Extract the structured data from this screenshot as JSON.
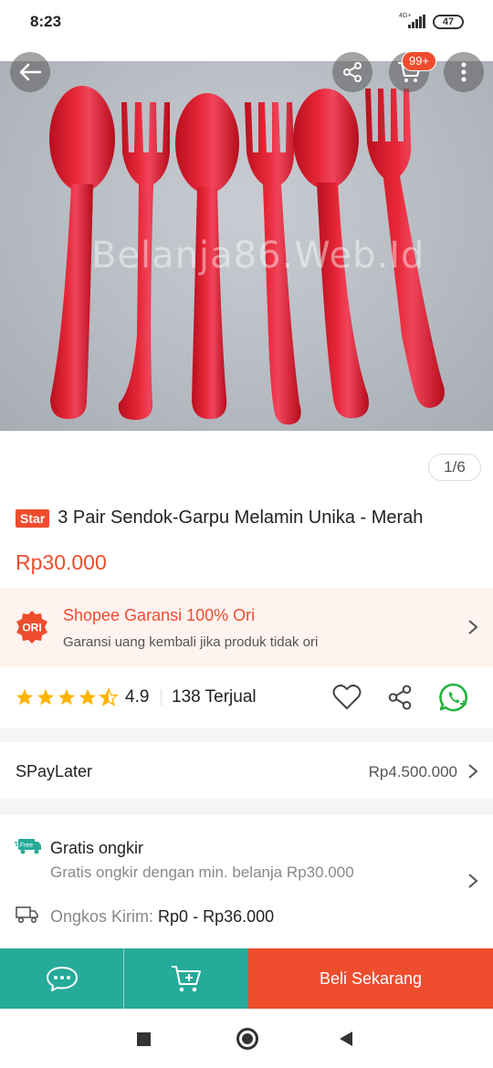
{
  "status_bar": {
    "time": "8:23",
    "network": "4G+",
    "battery": "47"
  },
  "hero": {
    "watermark": "Belanja86.Web.Id",
    "page_indicator": "1/6",
    "cart_badge": "99+"
  },
  "product": {
    "badge": "Star",
    "title": "3 Pair Sendok-Garpu Melamin Unika - Merah",
    "price": "Rp30.000"
  },
  "garansi": {
    "badge": "ORI",
    "title": "Shopee Garansi 100% Ori",
    "subtitle": "Garansi uang kembali jika produk tidak ori"
  },
  "rating": {
    "value": "4.9",
    "stars": 4.5,
    "sold": "138 Terjual"
  },
  "spaylater": {
    "label": "SPayLater",
    "value": "Rp4.500.000"
  },
  "shipping": {
    "free_badge": "Free",
    "title": "Gratis ongkir",
    "subtitle": "Gratis ongkir dengan min. belanja Rp30.000",
    "ongkos_label": "Ongkos Kirim:",
    "ongkos_value": "Rp0 - Rp36.000"
  },
  "bottom_bar": {
    "buy_label": "Beli Sekarang"
  },
  "colors": {
    "brand": "#ee4d2d",
    "teal": "#26aa99",
    "star": "#ffb400",
    "whatsapp": "#25b33f"
  }
}
